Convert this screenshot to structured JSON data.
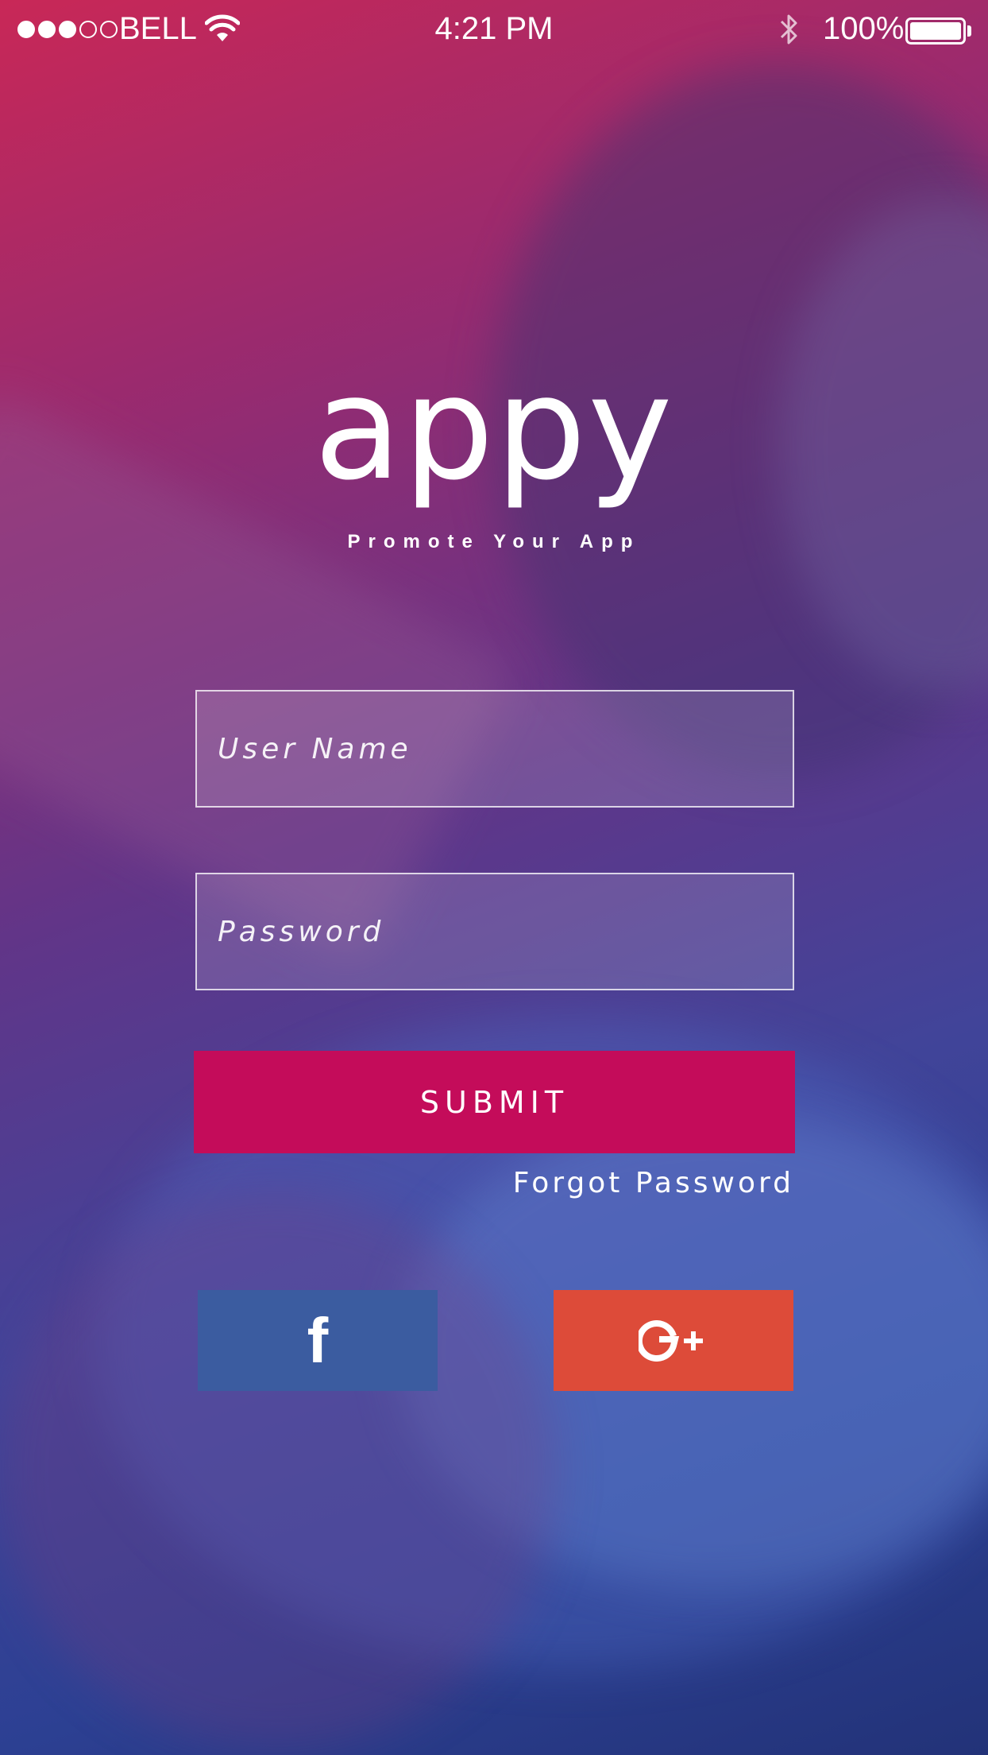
{
  "status_bar": {
    "signal": {
      "filled": 3,
      "total": 5
    },
    "carrier": "BELL",
    "wifi_icon": "wifi-icon",
    "time": "4:21 PM",
    "bluetooth_icon": "bluetooth-icon",
    "battery_percent": "100%",
    "battery_level": 1.0
  },
  "brand": {
    "logo": "appy",
    "tagline": "Promote Your App"
  },
  "login_form": {
    "username": {
      "placeholder": "User Name",
      "value": ""
    },
    "password": {
      "placeholder": "Password",
      "value": ""
    },
    "submit_label": "SUBMIT",
    "forgot_label": "Forgot Password"
  },
  "social": {
    "facebook": {
      "icon": "facebook-icon",
      "color": "#3b5ca0"
    },
    "google": {
      "icon": "google-plus-icon",
      "color": "#dd4b39"
    }
  },
  "colors": {
    "submit": "#c40c5a",
    "gradient_top": "#d62654",
    "gradient_bottom": "#223278"
  }
}
